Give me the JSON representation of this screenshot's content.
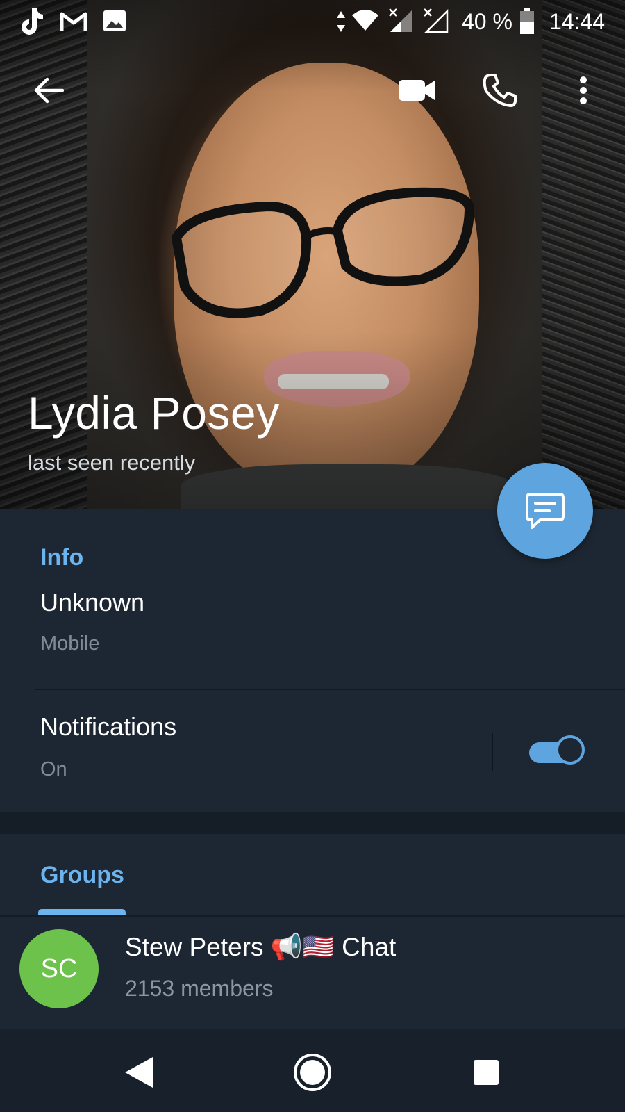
{
  "status_bar": {
    "left_icons": [
      "tiktok-icon",
      "gmail-icon",
      "image-icon"
    ],
    "battery": "40 %",
    "time": "14:44"
  },
  "toolbar": {
    "icons": [
      "back-arrow-icon",
      "video-call-icon",
      "phone-call-icon",
      "more-vert-icon"
    ]
  },
  "profile": {
    "name": "Lydia Posey",
    "status": "last seen recently"
  },
  "info": {
    "section_title": "Info",
    "phone_value": "Unknown",
    "phone_label": "Mobile",
    "notifications_label": "Notifications",
    "notifications_value": "On",
    "notifications_enabled": true
  },
  "groups": {
    "section_title": "Groups",
    "items": [
      {
        "initials": "SC",
        "title": "Stew Peters 📢🇺🇸 Chat",
        "subtitle": "2153 members",
        "avatar_color": "#6cc24a"
      }
    ]
  },
  "colors": {
    "accent": "#5ea5df",
    "section_title": "#6cb4ee",
    "background": "#1d2733"
  }
}
